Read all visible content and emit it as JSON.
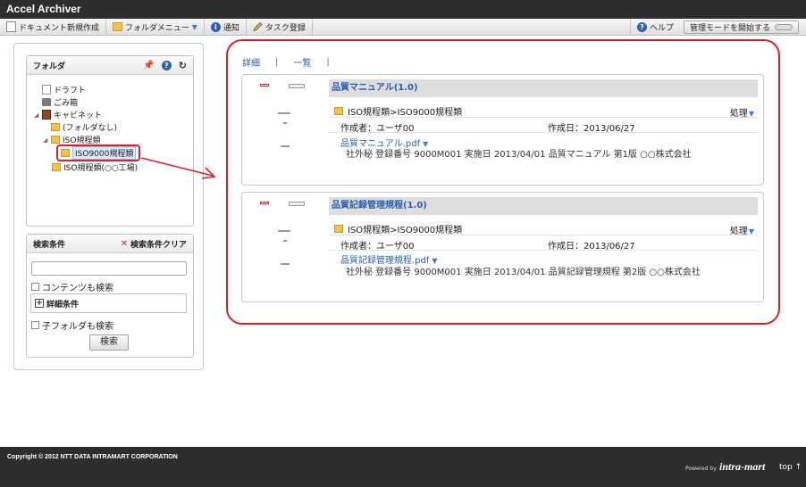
{
  "app": {
    "title": "Accel Archiver"
  },
  "toolbar": {
    "new_doc": "ドキュメント新規作成",
    "folder_menu": "フォルダメニュー",
    "notify": "通知",
    "task": "タスク登録",
    "help": "ヘルプ",
    "admin_mode": "管理モードを開始する"
  },
  "folder_panel": {
    "title": "フォルダ",
    "tree": {
      "draft": "ドラフト",
      "trash": "ごみ箱",
      "cabinet": "キャビネット",
      "no_folder": "(フォルダなし)",
      "iso": "ISO規程類",
      "iso9000": "ISO9000規程類",
      "iso_factory": "ISO規程類(○○工場)"
    }
  },
  "search_panel": {
    "title": "検索条件",
    "clear": "検索条件クリア",
    "input_value": "",
    "content_search": "コンテンツも検索",
    "detail": "詳細条件",
    "child_folder": "子フォルダも検索",
    "search_button": "検索"
  },
  "view_tabs": {
    "detail": "詳細",
    "list": "一覧"
  },
  "documents": [
    {
      "title": "品質マニュアル(1.0)",
      "path": "ISO規程類>ISO9000規程類",
      "action": "処理",
      "author": "作成者：ユーザ00",
      "created": "作成日：2013/06/27",
      "file": "品質マニュアル.pdf",
      "desc": "社外秘  登録番号 9000M001  実施日 2013/04/01 品質マニュアル 第1版 ○○株式会社"
    },
    {
      "title": "品質記録管理規程(1.0)",
      "path": "ISO規程類>ISO9000規程類",
      "action": "処理",
      "author": "作成者：ユーザ00",
      "created": "作成日：2013/06/27",
      "file": "品質記録管理規程.pdf",
      "desc": "社外秘  登録番号 9000M001  実施日 2013/04/01 品質記録管理規程 第2版 ○○株式会社"
    }
  ],
  "footer": {
    "copyright": "Copyright © 2012 NTT DATA INTRAMART CORPORATION",
    "powered": "Powered by",
    "logo": "intra-mart",
    "top": "top ↑"
  },
  "colors": {
    "highlight": "#d8212b",
    "link": "#2a5db0",
    "dark_bar": "#2d2d2d"
  }
}
